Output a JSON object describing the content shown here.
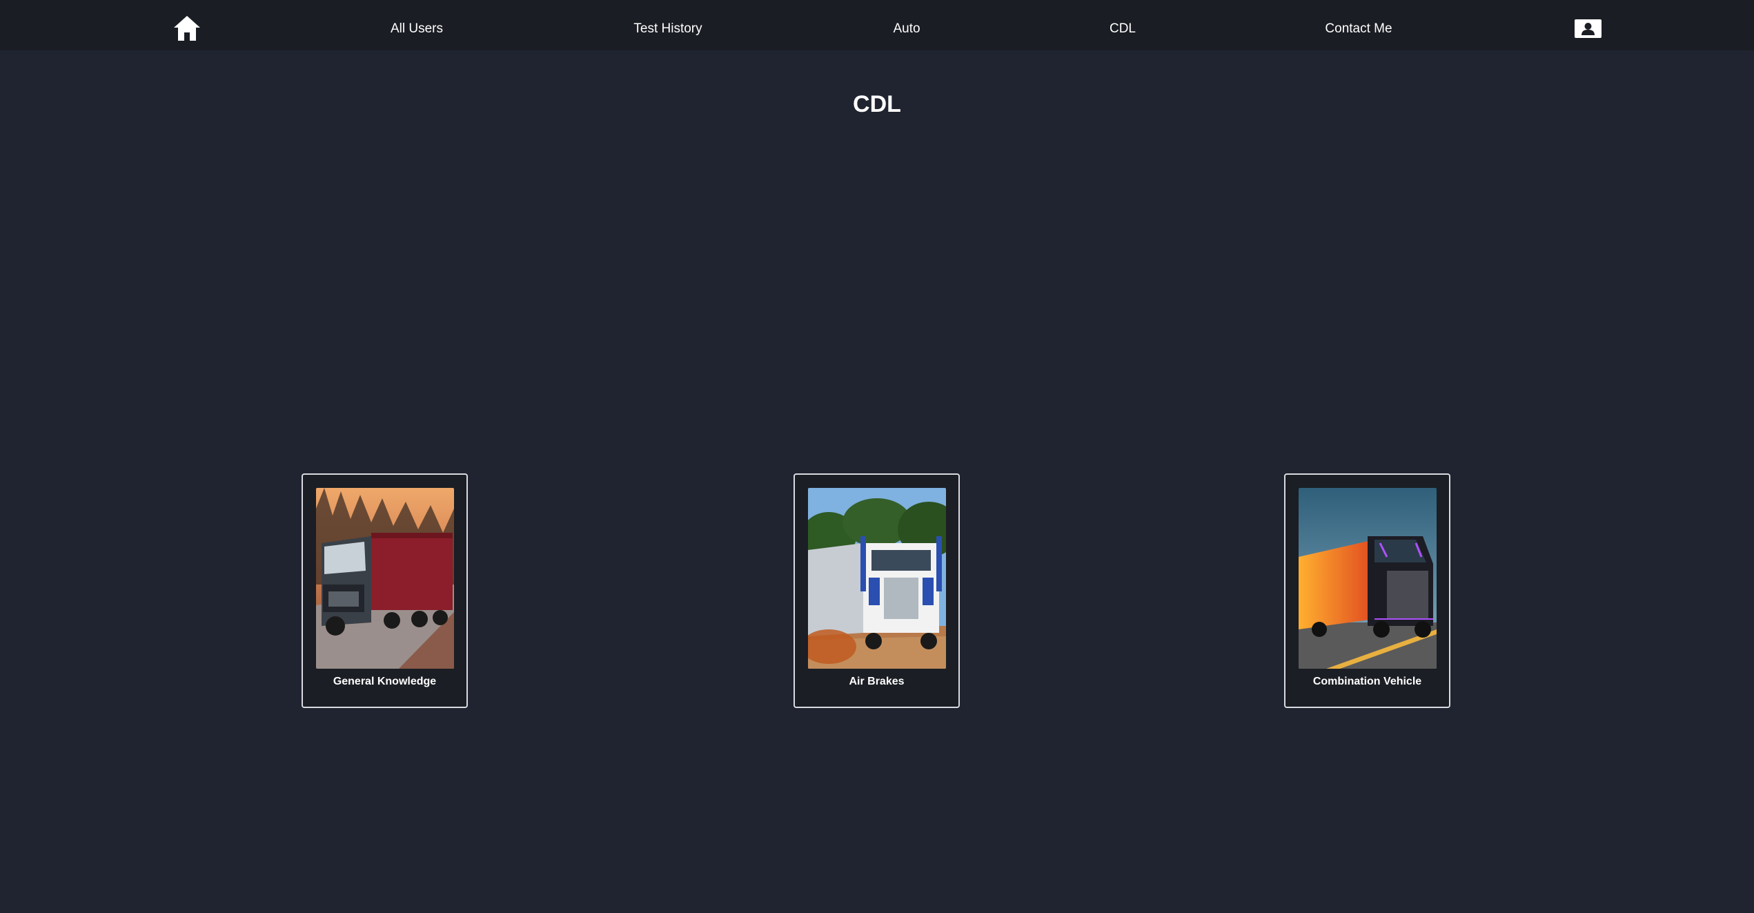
{
  "nav": {
    "home_icon": "home-icon",
    "links": [
      {
        "label": "All Users"
      },
      {
        "label": "Test History"
      },
      {
        "label": "Auto"
      },
      {
        "label": "CDL"
      },
      {
        "label": "Contact Me"
      }
    ],
    "profile_icon": "profile-card-icon"
  },
  "page": {
    "title": "CDL"
  },
  "cards": [
    {
      "label": "General Knowledge",
      "image": "red-trailer-truck-forest-image"
    },
    {
      "label": "Air Brakes",
      "image": "white-semi-truck-dirt-road-image"
    },
    {
      "label": "Combination Vehicle",
      "image": "futuristic-orange-truck-highway-image"
    }
  ],
  "colors": {
    "background": "#1f2430",
    "navbar": "#1a1d23",
    "card_border": "#d9dbe0",
    "text": "#ffffff"
  }
}
